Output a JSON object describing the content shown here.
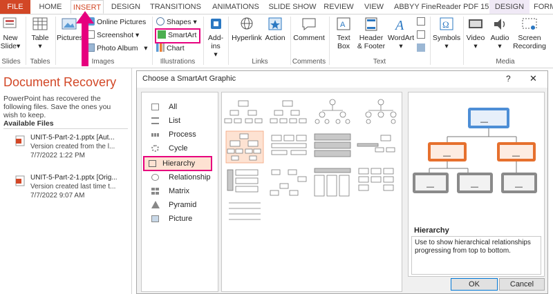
{
  "tabs": [
    "FILE",
    "HOME",
    "INSERT",
    "DESIGN",
    "TRANSITIONS",
    "ANIMATIONS",
    "SLIDE SHOW",
    "REVIEW",
    "VIEW",
    "ABBYY FineReader PDF 15",
    "DESIGN",
    "FORM"
  ],
  "ribbon": {
    "slides": {
      "new_slide_1": "New",
      "new_slide_2": "Slide",
      "layout_arrow": "▾",
      "group": "Slides"
    },
    "tables": {
      "table": "Table",
      "group": "Tables"
    },
    "images": {
      "pictures": "Pictures",
      "online_pictures": "Online Pictures",
      "screenshot": "Screenshot",
      "photo_album": "Photo Album",
      "group": "Images"
    },
    "illustrations": {
      "shapes": "Shapes",
      "smartart": "SmartArt",
      "chart": "Chart",
      "group": "Illustrations"
    },
    "addins": {
      "label_1": "Add-",
      "label_2": "ins"
    },
    "links": {
      "hyperlink": "Hyperlink",
      "action": "Action",
      "group": "Links"
    },
    "comments": {
      "comment": "Comment",
      "group": "Comments"
    },
    "text": {
      "textbox_1": "Text",
      "textbox_2": "Box",
      "header_1": "Header",
      "header_2": "& Footer",
      "wordart": "WordArt",
      "group": "Text"
    },
    "symbols": {
      "symbols": "Symbols"
    },
    "media": {
      "video": "Video",
      "audio": "Audio",
      "screen_1": "Screen",
      "screen_2": "Recording",
      "group": "Media"
    }
  },
  "recovery": {
    "title": "Document Recovery",
    "message": "PowerPoint has recovered the following files.  Save the ones you wish to keep.",
    "available": "Available Files",
    "files": [
      {
        "name": "UNIT-5-Part-2-1.pptx  [Aut...",
        "desc": "Version created from the l...",
        "date": "7/7/2022 1:22 PM"
      },
      {
        "name": "UNIT-5-Part-2-1.pptx  [Orig...",
        "desc": "Version created last time t...",
        "date": "7/7/2022 9:07 AM"
      }
    ]
  },
  "dialog": {
    "title": "Choose a SmartArt Graphic",
    "help": "?",
    "close": "✕",
    "categories": [
      "All",
      "List",
      "Process",
      "Cycle",
      "Hierarchy",
      "Relationship",
      "Matrix",
      "Pyramid",
      "Picture"
    ],
    "selected_category": "Hierarchy",
    "preview_name": "Hierarchy",
    "preview_desc": "Use to show hierarchical relationships progressing from top to bottom.",
    "dash": "—",
    "ok": "OK",
    "cancel": "Cancel"
  },
  "colors": {
    "accent_file": "#d24726",
    "highlight": "#e6007e",
    "node_blue": "#4d8ed6",
    "node_orange": "#e6702e",
    "node_gray": "#8a8a8a"
  },
  "icons": [
    "new-slide-icon",
    "table-icon",
    "pictures-icon",
    "online-pictures-icon",
    "screenshot-icon",
    "photo-album-icon",
    "shapes-icon",
    "smartart-icon",
    "chart-icon",
    "addins-icon",
    "hyperlink-icon",
    "action-icon",
    "comment-icon",
    "textbox-icon",
    "header-footer-icon",
    "wordart-icon",
    "symbols-icon",
    "video-icon",
    "audio-icon",
    "screen-recording-icon",
    "pptx-file-icon",
    "arrow-pointer"
  ]
}
